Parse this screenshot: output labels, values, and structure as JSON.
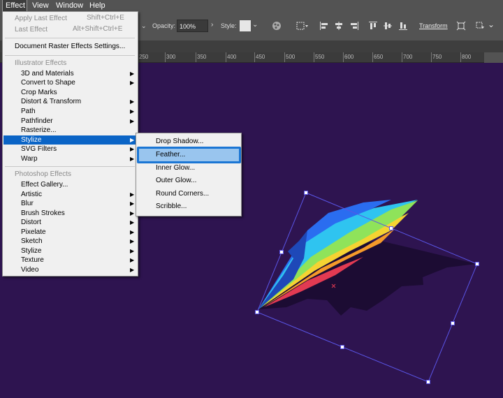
{
  "menubar": {
    "items": [
      "Effect",
      "View",
      "Window",
      "Help"
    ]
  },
  "controlbar": {
    "opacity_label": "Opacity:",
    "opacity_value": "100%",
    "style_label": "Style:",
    "transform_label": "Transform"
  },
  "ruler": {
    "ticks": [
      "250",
      "300",
      "350",
      "400",
      "450",
      "500",
      "550",
      "600",
      "650",
      "700",
      "750",
      "800"
    ]
  },
  "effect_menu": {
    "apply_last": "Apply Last Effect",
    "apply_last_shortcut": "Shift+Ctrl+E",
    "last_effect": "Last Effect",
    "last_effect_shortcut": "Alt+Shift+Ctrl+E",
    "doc_raster": "Document Raster Effects Settings...",
    "illustrator_header": "Illustrator Effects",
    "illustrator_items": [
      "3D and Materials",
      "Convert to Shape",
      "Crop Marks",
      "Distort & Transform",
      "Path",
      "Pathfinder",
      "Rasterize...",
      "Stylize",
      "SVG Filters",
      "Warp"
    ],
    "photoshop_header": "Photoshop Effects",
    "photoshop_items": [
      "Effect Gallery...",
      "Artistic",
      "Blur",
      "Brush Strokes",
      "Distort",
      "Pixelate",
      "Sketch",
      "Stylize",
      "Texture",
      "Video"
    ]
  },
  "stylize_submenu": {
    "items": [
      "Drop Shadow...",
      "Feather...",
      "Inner Glow...",
      "Outer Glow...",
      "Round Corners...",
      "Scribble..."
    ]
  },
  "colors": {
    "canvas": "#2e1450",
    "highlight": "#0a64c6",
    "bbox": "#5a55e6"
  }
}
